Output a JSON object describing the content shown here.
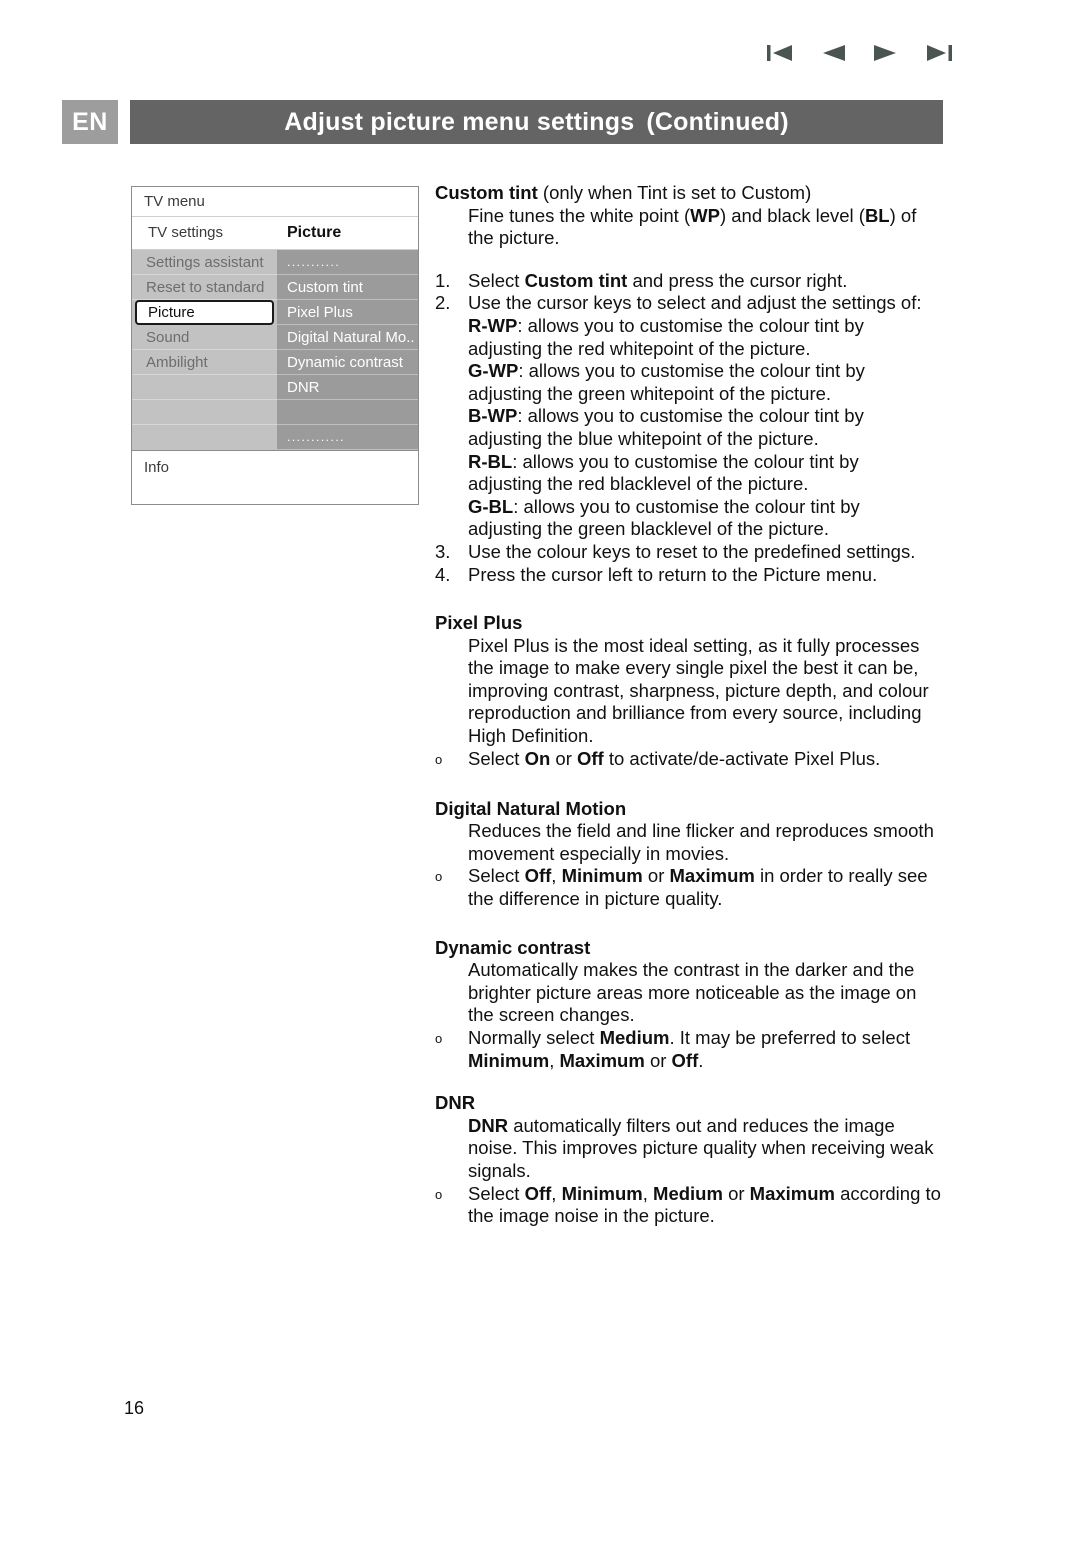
{
  "nav": {
    "first_label": "first-page",
    "prev_label": "previous-page",
    "next_label": "next-page",
    "last_label": "last-page"
  },
  "header": {
    "language": "EN",
    "title": "Adjust picture menu settings",
    "continued": "(Continued)",
    "badge_color": "#9d9d9d",
    "bar_color": "#646464"
  },
  "tv_menu": {
    "title": "TV menu",
    "subhead_left": "TV settings",
    "subhead_right": "Picture",
    "left_items": [
      {
        "label": "Settings assistant",
        "selected": false
      },
      {
        "label": "Reset to standard",
        "selected": false
      },
      {
        "label": "Picture",
        "selected": true
      },
      {
        "label": "Sound",
        "selected": false
      },
      {
        "label": "Ambilight",
        "selected": false
      },
      {
        "label": "",
        "selected": false
      },
      {
        "label": "",
        "selected": false
      }
    ],
    "right_items": [
      {
        "label": "...........",
        "dots": true
      },
      {
        "label": "Custom tint",
        "dots": false
      },
      {
        "label": "Pixel Plus",
        "dots": false
      },
      {
        "label": "Digital Natural Mo..",
        "dots": false
      },
      {
        "label": "Dynamic contrast",
        "dots": false
      },
      {
        "label": "DNR",
        "dots": false
      },
      {
        "label": "",
        "dots": false
      },
      {
        "label": "............",
        "dots": true
      }
    ],
    "footer": "Info"
  },
  "content": {
    "custom_tint": {
      "heading": "Custom tint",
      "heading_note": "(only when Tint is set to Custom)",
      "intro_1": "Fine tunes the white point (",
      "intro_wp": "WP",
      "intro_2": ") and black level (",
      "intro_bl": "BL",
      "intro_3": ") of",
      "intro_line2": "the picture.",
      "step1_num": "1.",
      "step1_a": "Select ",
      "step1_b": "Custom tint",
      "step1_c": " and press the cursor right.",
      "step2_num": "2.",
      "step2_text": "Use the cursor keys to select and adjust the settings of:",
      "defs": [
        {
          "key": "R-WP",
          "line1": ": allows you to customise the colour tint by",
          "line2": "adjusting the red whitepoint of the picture."
        },
        {
          "key": "G-WP",
          "line1": ": allows you to customise the colour tint by",
          "line2": "adjusting the green whitepoint of the picture."
        },
        {
          "key": "B-WP",
          "line1": ": allows you to customise the colour tint by",
          "line2": "adjusting the blue whitepoint of the picture."
        },
        {
          "key": "R-BL",
          "line1": ": allows you to customise the colour tint by",
          "line2": "adjusting the red blacklevel of the picture."
        },
        {
          "key": "G-BL",
          "line1": ": allows you to customise the colour tint by",
          "line2": "adjusting the green blacklevel of the picture."
        }
      ],
      "step3_num": "3.",
      "step3_text": "Use the colour keys to reset to the predefined settings.",
      "step4_num": "4.",
      "step4_text": "Press the cursor left to return to the Picture menu."
    },
    "pixel_plus": {
      "heading": "Pixel Plus",
      "body": "Pixel Plus is the most ideal setting, as it fully processes the image to make every single pixel the best it can be, improving contrast, sharpness, picture depth, and colour reproduction and brilliance from every source, including High Definition.",
      "bullet_marker": "o",
      "bullet_a": "Select ",
      "bullet_on": "On",
      "bullet_b": " or ",
      "bullet_off": "Off",
      "bullet_c": " to activate/de-activate Pixel Plus."
    },
    "dnm": {
      "heading": "Digital Natural Motion",
      "body": "Reduces the field and line flicker and reproduces smooth movement especially in movies.",
      "bullet_marker": "o",
      "bullet_a": "Select ",
      "bullet_off": "Off",
      "bullet_b": ", ",
      "bullet_min": "Minimum",
      "bullet_c": " or ",
      "bullet_max": "Maximum",
      "bullet_d": " in order to really see the difference in picture quality."
    },
    "dynamic_contrast": {
      "heading": "Dynamic contrast",
      "body": "Automatically makes the contrast in the darker and the brighter picture areas more noticeable as the image on the screen changes.",
      "bullet_marker": "o",
      "bullet_a": "Normally select ",
      "bullet_medium": "Medium",
      "bullet_b": ". It may be preferred to select ",
      "bullet_min": "Minimum",
      "bullet_c": ", ",
      "bullet_max": "Maximum",
      "bullet_d": " or ",
      "bullet_off": "Off",
      "bullet_e": "."
    },
    "dnr": {
      "heading": "DNR",
      "body_key": "DNR",
      "body": " automatically filters out and reduces the image noise. This improves picture quality when receiving weak signals.",
      "bullet_marker": "o",
      "bullet_a": "Select ",
      "bullet_off": "Off",
      "bullet_b": ", ",
      "bullet_min": "Minimum",
      "bullet_c": ", ",
      "bullet_medium": "Medium",
      "bullet_d": " or ",
      "bullet_max": "Maximum",
      "bullet_e": " according to the image noise in the picture."
    }
  },
  "footer": {
    "page_number": "16"
  }
}
